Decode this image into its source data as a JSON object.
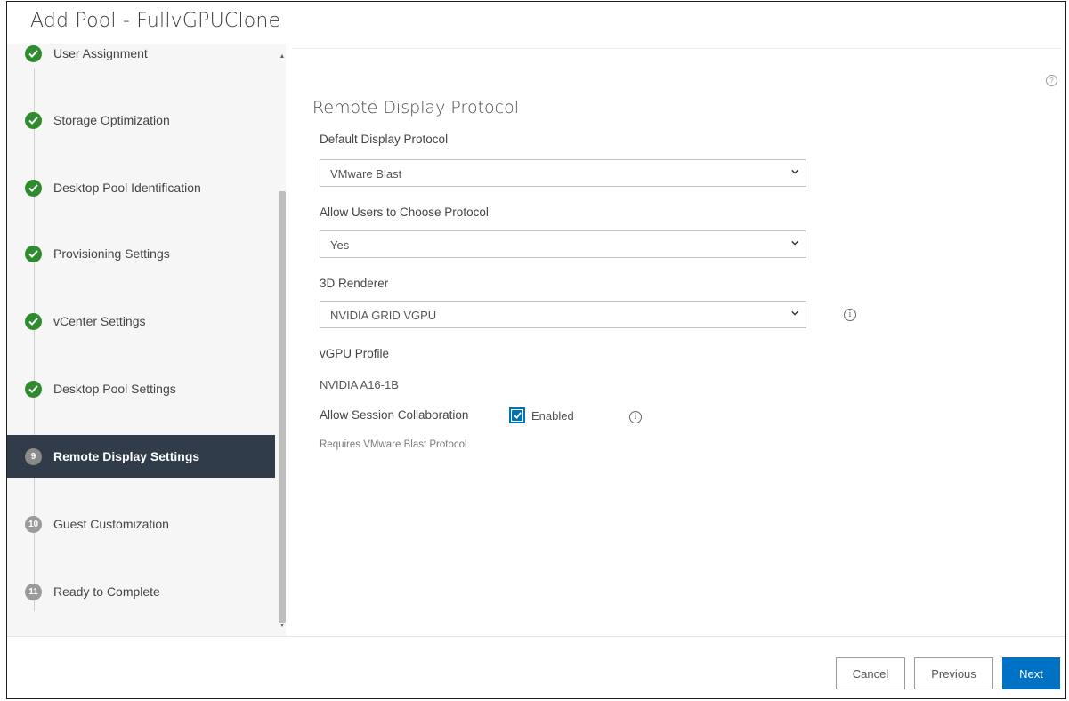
{
  "dialog": {
    "title": "Add Pool - FullvGPUClone"
  },
  "wizard": {
    "steps": [
      {
        "label": "User Assignment",
        "state": "done",
        "marker": ""
      },
      {
        "label": "Storage Optimization",
        "state": "done",
        "marker": ""
      },
      {
        "label": "Desktop Pool Identification",
        "state": "done",
        "marker": ""
      },
      {
        "label": "Provisioning Settings",
        "state": "done",
        "marker": ""
      },
      {
        "label": "vCenter Settings",
        "state": "done",
        "marker": ""
      },
      {
        "label": "Desktop Pool Settings",
        "state": "done",
        "marker": ""
      },
      {
        "label": "Remote Display Settings",
        "state": "current",
        "marker": "9"
      },
      {
        "label": "Guest Customization",
        "state": "pending",
        "marker": "10"
      },
      {
        "label": "Ready to Complete",
        "state": "pending",
        "marker": "11"
      }
    ]
  },
  "section": {
    "title": "Remote Display Protocol"
  },
  "fields": {
    "default_protocol": {
      "label": "Default Display Protocol",
      "value": "VMware Blast"
    },
    "allow_choose": {
      "label": "Allow Users to Choose Protocol",
      "value": "Yes"
    },
    "renderer": {
      "label": "3D Renderer",
      "value": "NVIDIA GRID VGPU"
    },
    "vgpu_profile": {
      "label": "vGPU Profile",
      "value": "NVIDIA A16-1B"
    },
    "session_collab": {
      "label": "Allow Session Collaboration",
      "checkbox_label": "Enabled",
      "checked": true,
      "note": "Requires VMware Blast Protocol"
    }
  },
  "buttons": {
    "cancel": "Cancel",
    "previous": "Previous",
    "next": "Next"
  },
  "colors": {
    "accent": "#0072c6",
    "active_step_bg": "#313c4b",
    "done_green": "#2e8b2e"
  }
}
